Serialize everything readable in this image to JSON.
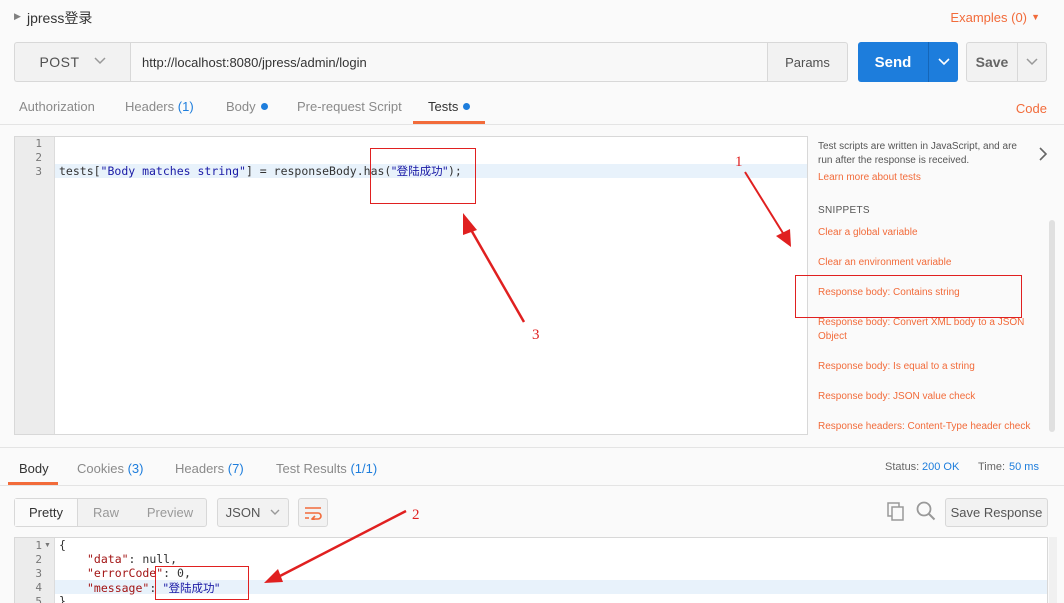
{
  "request": {
    "name": "jpress登录",
    "examples_label": "Examples (0)",
    "method": "POST",
    "url": "http://localhost:8080/jpress/admin/login",
    "params_label": "Params",
    "send_label": "Send",
    "save_label": "Save"
  },
  "request_tabs": {
    "authorization": "Authorization",
    "headers": "Headers",
    "headers_count": "(1)",
    "body": "Body",
    "prerequest": "Pre-request Script",
    "tests": "Tests",
    "active": "Tests",
    "code_link": "Code"
  },
  "editor": {
    "line_numbers": [
      "1",
      "2",
      "3"
    ],
    "active_line": 3,
    "code_prefix": "tests[",
    "code_string1": "\"Body matches string\"",
    "code_mid": "] = responseBody.has(",
    "code_string2": "\"登陆成功\"",
    "code_suffix": ");"
  },
  "snippets_panel": {
    "description": "Test scripts are written in JavaScript, and are run after the response is received.",
    "learn_more": "Learn more about tests",
    "heading": "SNIPPETS",
    "items": [
      "Clear a global variable",
      "Clear an environment variable",
      "Response body: Contains string",
      "Response body: Convert XML body to a JSON Object",
      "Response body: Is equal to a string",
      "Response body: JSON value check",
      "Response headers: Content-Type header check"
    ]
  },
  "response": {
    "tabs": {
      "body": "Body",
      "cookies": "Cookies",
      "cookies_count": "(3)",
      "headers": "Headers",
      "headers_count": "(7)",
      "test_results": "Test Results",
      "test_results_count": "(1/1)"
    },
    "status_label": "Status:",
    "status_value": "200 OK",
    "time_label": "Time:",
    "time_value": "50 ms",
    "view_modes": [
      "Pretty",
      "Raw",
      "Preview"
    ],
    "active_view": "Pretty",
    "format": "JSON",
    "save_response_label": "Save Response",
    "body_lines": {
      "line_numbers": [
        "1",
        "2",
        "3",
        "4",
        "5"
      ],
      "l1": "{",
      "l2_key": "\"data\"",
      "l2_val": ": null,",
      "l3_key": "\"errorCode\"",
      "l3_val": ": 0,",
      "l4_key": "\"message\"",
      "l4_colon": ": ",
      "l4_val": "\"登陆成功\"",
      "l5": "}"
    }
  },
  "annotations": {
    "numbers": [
      "1",
      "2",
      "3"
    ],
    "color": "#e02020"
  },
  "colors": {
    "accent_orange": "#f26b3a",
    "primary_blue": "#1d7ddc"
  }
}
